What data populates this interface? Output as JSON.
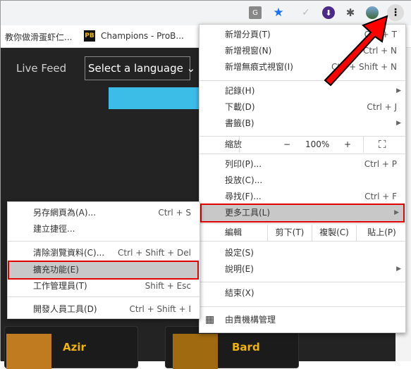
{
  "toolbar": {
    "icons": [
      "translate-icon",
      "star-icon",
      "check-icon",
      "download-icon",
      "extensions-icon",
      "avatar",
      "menu-dots-icon"
    ]
  },
  "bookmarks": [
    {
      "label": "教你做滑蛋虾仁..."
    },
    {
      "label": "Champions - ProB...",
      "icon": "PB"
    }
  ],
  "header": {
    "live_feed": "Live Feed",
    "language_select": "Select a language"
  },
  "cards": [
    {
      "name": "Azir"
    },
    {
      "name": "Bard"
    }
  ],
  "menu": {
    "new_tab": {
      "label": "新增分頁(T)",
      "shortcut": "Ctrl + T"
    },
    "new_window": {
      "label": "新增視窗(N)",
      "shortcut": "Ctrl + N"
    },
    "incognito": {
      "label": "新增無痕式視窗(I)",
      "shortcut": "Ctrl + Shift + N"
    },
    "history": {
      "label": "記錄(H)"
    },
    "downloads": {
      "label": "下載(D)",
      "shortcut": "Ctrl + J"
    },
    "bookmarks": {
      "label": "書籤(B)"
    },
    "zoom": {
      "label": "縮放",
      "minus": "−",
      "value": "100%",
      "plus": "+"
    },
    "print": {
      "label": "列印(P)...",
      "shortcut": "Ctrl + P"
    },
    "cast": {
      "label": "投放(C)..."
    },
    "find": {
      "label": "尋找(F)...",
      "shortcut": "Ctrl + F"
    },
    "more_tools": {
      "label": "更多工具(L)"
    },
    "edit": {
      "label": "編輯",
      "cut": "剪下(T)",
      "copy": "複製(C)",
      "paste": "貼上(P)"
    },
    "settings": {
      "label": "設定(S)"
    },
    "help": {
      "label": "說明(E)"
    },
    "exit": {
      "label": "結束(X)"
    },
    "managed": {
      "label": "由貴機構管理"
    }
  },
  "submenu": {
    "save_page": {
      "label": "另存網頁為(A)...",
      "shortcut": "Ctrl + S"
    },
    "shortcut": {
      "label": "建立捷徑..."
    },
    "clear_data": {
      "label": "清除瀏覽資料(C)...",
      "shortcut": "Ctrl + Shift + Del"
    },
    "extensions": {
      "label": "擴充功能(E)"
    },
    "task_manager": {
      "label": "工作管理員(T)",
      "shortcut": "Shift + Esc"
    },
    "dev_tools": {
      "label": "開發人員工具(D)",
      "shortcut": "Ctrl + Shift + I"
    }
  },
  "colors": {
    "highlight_border": "#e00000",
    "arrow": "#ff0000",
    "champion_name": "#f0b400"
  }
}
